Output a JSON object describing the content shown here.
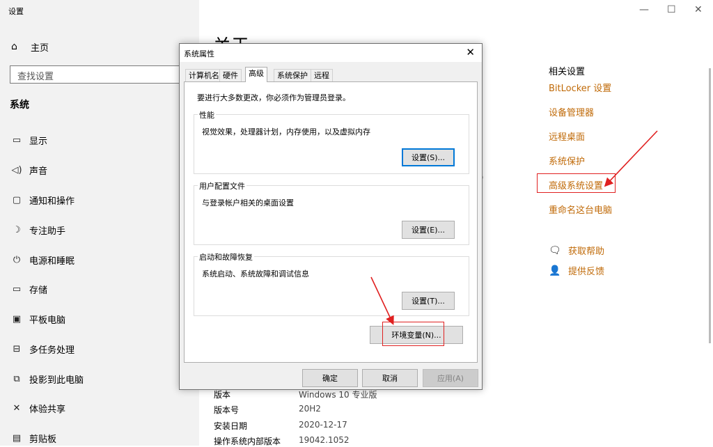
{
  "app_title": "设置",
  "sidebar": {
    "home": "主页",
    "search_placeholder": "查找设置",
    "section": "系统",
    "items": [
      {
        "label": "显示",
        "icon": "display-icon"
      },
      {
        "label": "声音",
        "icon": "speaker-icon"
      },
      {
        "label": "通知和操作",
        "icon": "notification-icon"
      },
      {
        "label": "专注助手",
        "icon": "moon-icon"
      },
      {
        "label": "电源和睡眠",
        "icon": "power-icon"
      },
      {
        "label": "存储",
        "icon": "storage-icon"
      },
      {
        "label": "平板电脑",
        "icon": "tablet-icon"
      },
      {
        "label": "多任务处理",
        "icon": "multitask-icon"
      },
      {
        "label": "投影到此电脑",
        "icon": "project-icon"
      },
      {
        "label": "体验共享",
        "icon": "share-icon"
      },
      {
        "label": "剪贴板",
        "icon": "clipboard-icon"
      }
    ]
  },
  "main": {
    "title": "关于",
    "stray_char": ")",
    "info": [
      {
        "key": "版本",
        "value": "Windows 10 专业版"
      },
      {
        "key": "版本号",
        "value": "20H2"
      },
      {
        "key": "安装日期",
        "value": "2020-12-17"
      },
      {
        "key": "操作系统内部版本",
        "value": "19042.1052"
      }
    ]
  },
  "related": {
    "heading": "相关设置",
    "links": [
      "BitLocker 设置",
      "设备管理器",
      "远程桌面",
      "系统保护",
      "高级系统设置",
      "重命名这台电脑"
    ],
    "help": "获取帮助",
    "feedback": "提供反馈"
  },
  "dialog": {
    "title": "系统属性",
    "tabs": [
      "计算机名",
      "硬件",
      "高级",
      "系统保护",
      "远程"
    ],
    "active_tab": 2,
    "admin_note": "要进行大多数更改，你必须作为管理员登录。",
    "groups": [
      {
        "title": "性能",
        "desc": "视觉效果，处理器计划，内存使用，以及虚拟内存",
        "button": "设置(S)..."
      },
      {
        "title": "用户配置文件",
        "desc": "与登录帐户相关的桌面设置",
        "button": "设置(E)..."
      },
      {
        "title": "启动和故障恢复",
        "desc": "系统启动、系统故障和调试信息",
        "button": "设置(T)..."
      }
    ],
    "env_button": "环境变量(N)...",
    "ok": "确定",
    "cancel": "取消",
    "apply": "应用(A)"
  },
  "colors": {
    "link": "#c06a08",
    "annotation": "#e02020",
    "focus": "#0078d7"
  }
}
